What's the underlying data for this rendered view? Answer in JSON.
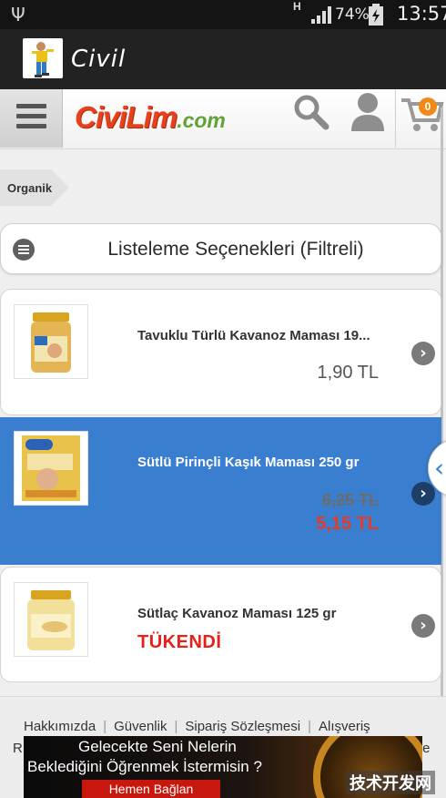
{
  "status_bar": {
    "network": "H",
    "battery": "74%",
    "time": "13:57"
  },
  "app_bar": {
    "title": "Civil"
  },
  "header": {
    "logo_main": "CiviLim",
    "logo_suffix": ".com",
    "cart_count": "0"
  },
  "breadcrumb": {
    "label": "Organik"
  },
  "filter": {
    "title": "Listeleme Seçenekleri (Filtreli)"
  },
  "products": [
    {
      "name": "Tavuklu Türlü Kavanoz Maması 19...",
      "price": "1,90 TL"
    },
    {
      "name": "Sütlü Pirinçli Kaşık Maması 250 gr",
      "old_price": "6,25 TL",
      "new_price": "5,15 TL"
    },
    {
      "name": "Sütlaç Kavanoz Maması 125 gr",
      "status": "TÜKENDİ"
    }
  ],
  "footer": {
    "links": [
      "Hakkımızda",
      "Güvenlik",
      "Sipariş Sözleşmesi",
      "Alışveriş"
    ],
    "fragment_left": "R",
    "fragment_right": "te"
  },
  "ad": {
    "line1": "Gelecekte Seni Nelerin",
    "line2": "Beklediğini Öğrenmek İstermisin ?",
    "button": "Hemen Bağlan"
  },
  "watermark": "技术开发网",
  "colors": {
    "accent": "#3a7fcf",
    "sale": "#e23b2a",
    "soldout": "#e8201a",
    "badge": "#f08a16"
  }
}
